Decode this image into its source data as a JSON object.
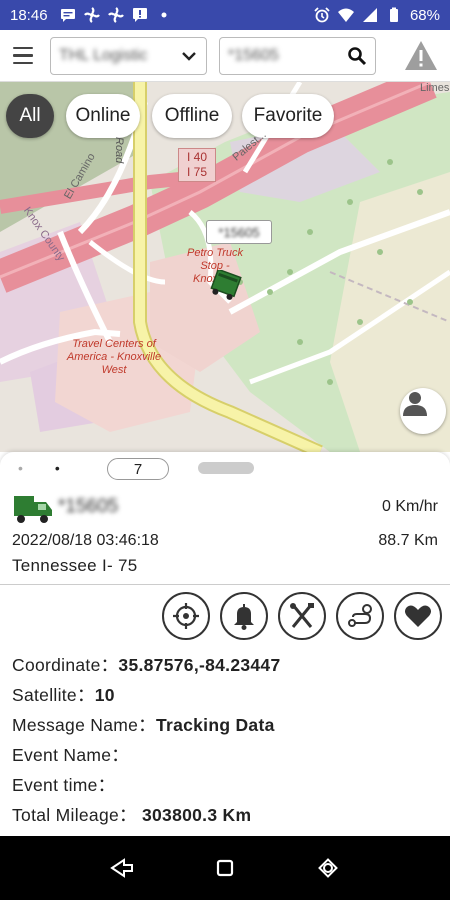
{
  "status_bar": {
    "time": "18:46",
    "battery": "68%",
    "icons_left": [
      "message-icon",
      "fan-icon",
      "fan-icon",
      "chat-icon",
      "dot-icon"
    ],
    "icons_right": [
      "alarm-icon",
      "wifi-icon",
      "signal-icon",
      "battery-icon"
    ]
  },
  "appbar": {
    "company": "THL Logistic",
    "search_value": "*15605"
  },
  "map": {
    "filters": [
      {
        "label": "All",
        "active": true
      },
      {
        "label": "Online",
        "active": false
      },
      {
        "label": "Offline",
        "active": false
      },
      {
        "label": "Favorite",
        "active": false
      }
    ],
    "highway_shield": "I 40\nI 75",
    "vehicle_tag": "*15605",
    "labels": {
      "petro": "Petro Truck Stop - Knoxville",
      "travel_centers": "Travel Centers of America - Knoxville West",
      "road": "Road",
      "el_camino": "El Camino",
      "palestine": "Palest...",
      "knox_county": "Knox County",
      "limes": "Limes"
    }
  },
  "panel": {
    "pager_dots": [
      "•",
      "•"
    ],
    "vehicle_count": "7",
    "plate": "*15605",
    "speed": "0  Km/hr",
    "datetime": "2022/08/18 03:46:18",
    "mileage_short": "88.7  Km",
    "location": "Tennessee  I- 75",
    "actions": [
      "target-icon",
      "bell-icon",
      "tools-icon",
      "route-icon",
      "heart-icon"
    ],
    "details": [
      {
        "label": "Coordinate：",
        "value": "35.87576,-84.23447"
      },
      {
        "label": "Satellite：",
        "value": "10"
      },
      {
        "label": "Message Name：",
        "value": "Tracking Data"
      },
      {
        "label": "Event Name：",
        "value": ""
      },
      {
        "label": "Event time：",
        "value": ""
      },
      {
        "label": "Total Mileage：",
        "value": " 303800.3  Km"
      }
    ]
  },
  "colors": {
    "status_bar": "#3949ab",
    "highway": "#e9909a",
    "road_yellow": "#f6f2a5",
    "park_green": "#cde6c0",
    "truck_green": "#2e7d32"
  }
}
